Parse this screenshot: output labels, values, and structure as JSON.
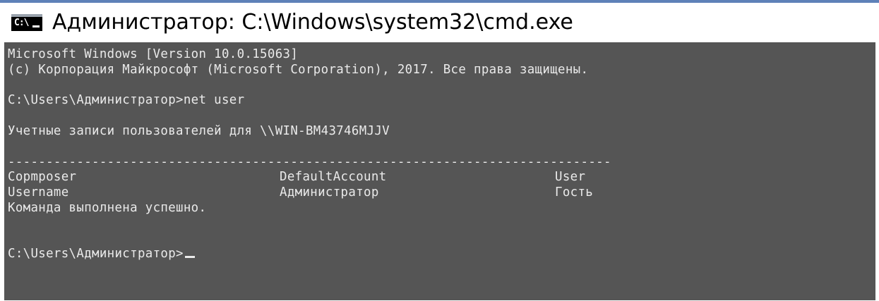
{
  "window": {
    "title": "Администратор: C:\\Windows\\system32\\cmd.exe",
    "icon": "cmd-icon",
    "icon_text": "C:\\"
  },
  "console": {
    "version_line": "Microsoft Windows [Version 10.0.15063]",
    "copyright_line": "(с) Корпорация Майкрософт (Microsoft Corporation), 2017. Все права защищены.",
    "command_line": "C:\\Users\\Администратор>net user",
    "accounts_header": "Учетные записи пользователей для \\\\WIN-BM43746MJJV",
    "separator": "-------------------------------------------------------------------------------",
    "accounts": [
      [
        "Copmposer",
        "DefaultAccount",
        "User"
      ],
      [
        "Username",
        "Администратор",
        "Гость"
      ]
    ],
    "status_line": "Команда выполнена успешно.",
    "prompt": "C:\\Users\\Администратор>"
  },
  "colors": {
    "console_background": "#555555",
    "console_text": "#eaeaea",
    "window_border": "#5e81b8"
  }
}
